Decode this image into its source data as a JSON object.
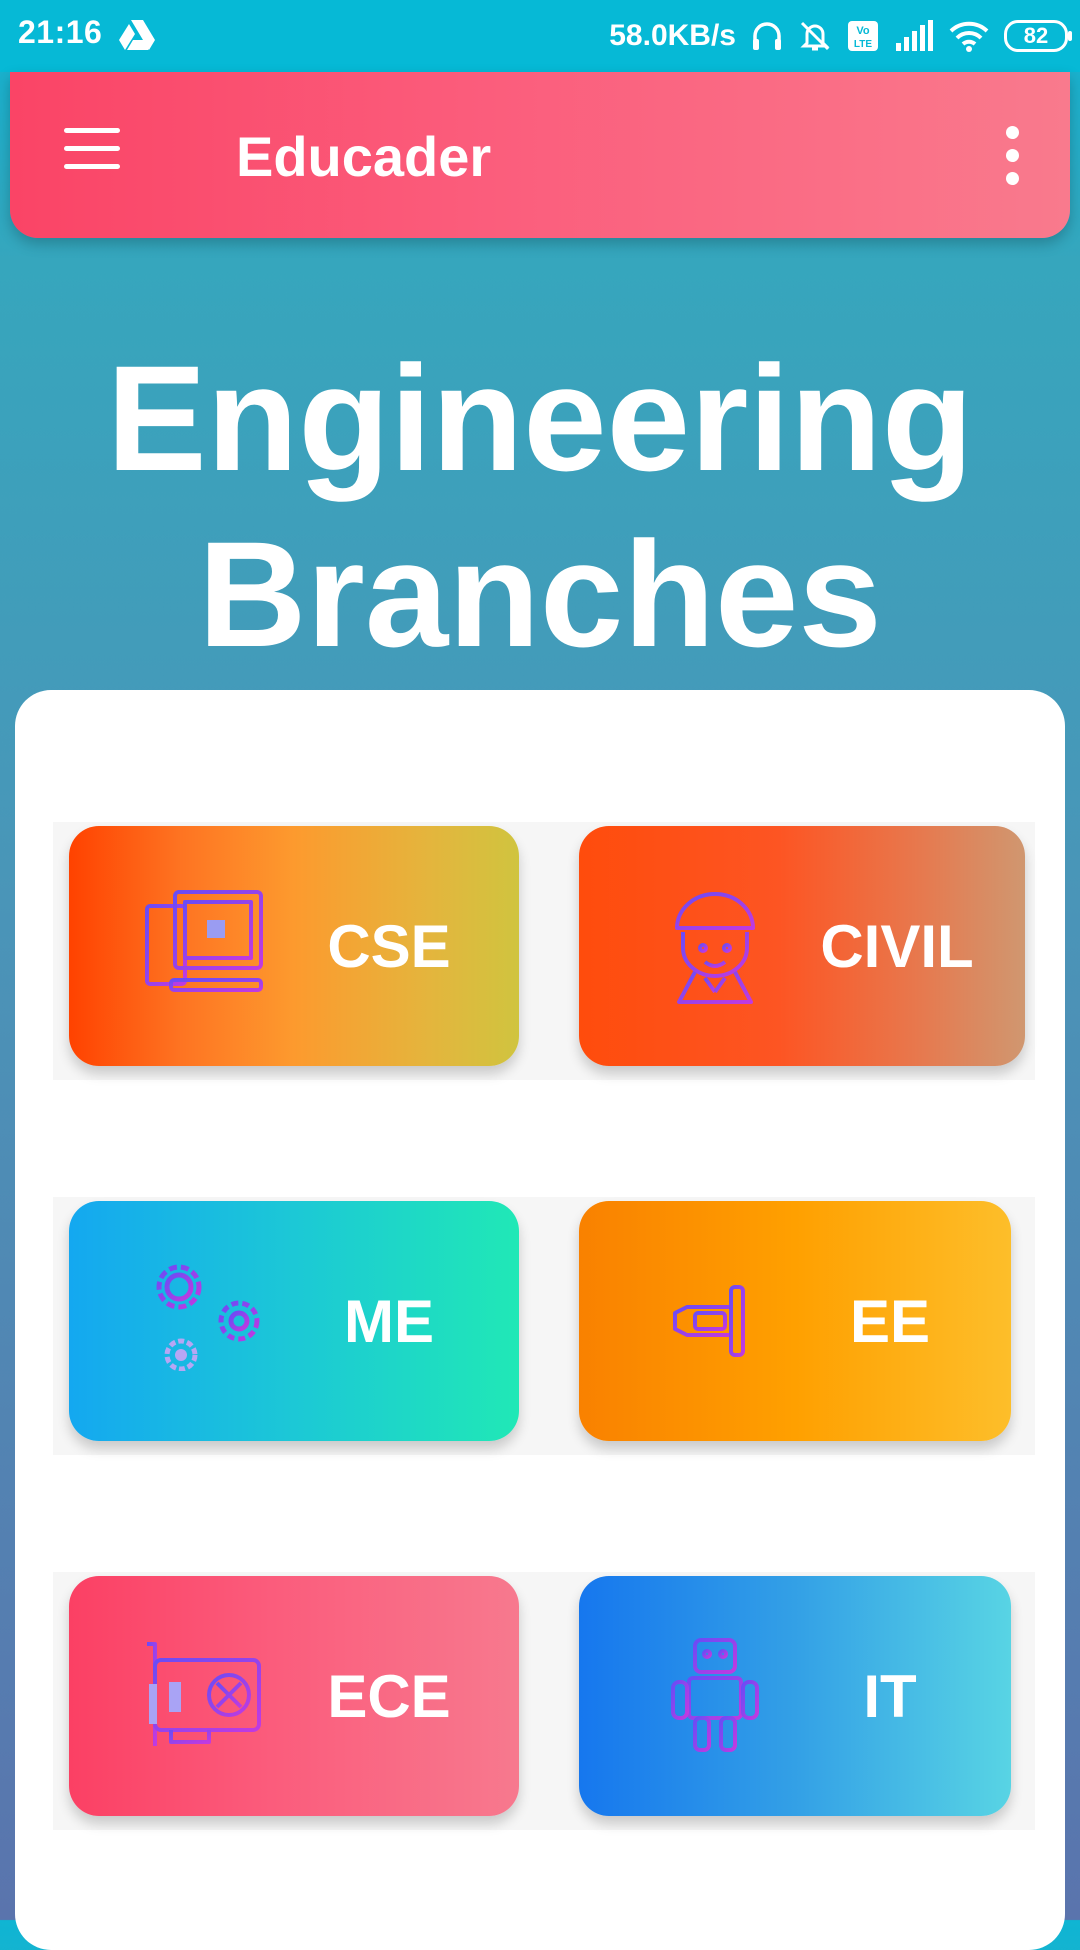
{
  "status_bar": {
    "time": "21:16",
    "net_speed": "58.0KB/s",
    "battery": "82"
  },
  "app_bar": {
    "title": "Educader",
    "menu_icon": "hamburger-menu-icon",
    "more_icon": "more-vert-icon"
  },
  "page": {
    "title_line1": "Engineering",
    "title_line2": "Branches"
  },
  "branches": [
    {
      "label": "CSE",
      "icon": "computer-icon"
    },
    {
      "label": "CIVIL",
      "icon": "engineer-helmet-icon"
    },
    {
      "label": "ME",
      "icon": "gears-icon"
    },
    {
      "label": "EE",
      "icon": "plug-icon"
    },
    {
      "label": "ECE",
      "icon": "circuit-card-icon"
    },
    {
      "label": "IT",
      "icon": "robot-icon"
    }
  ],
  "colors": {
    "status_bar": "#06b9d6",
    "app_bar_start": "#fa4466",
    "app_bar_end": "#f97a8d",
    "icon_stroke_start": "#6a4cf5",
    "icon_stroke_end": "#c13ae0"
  }
}
